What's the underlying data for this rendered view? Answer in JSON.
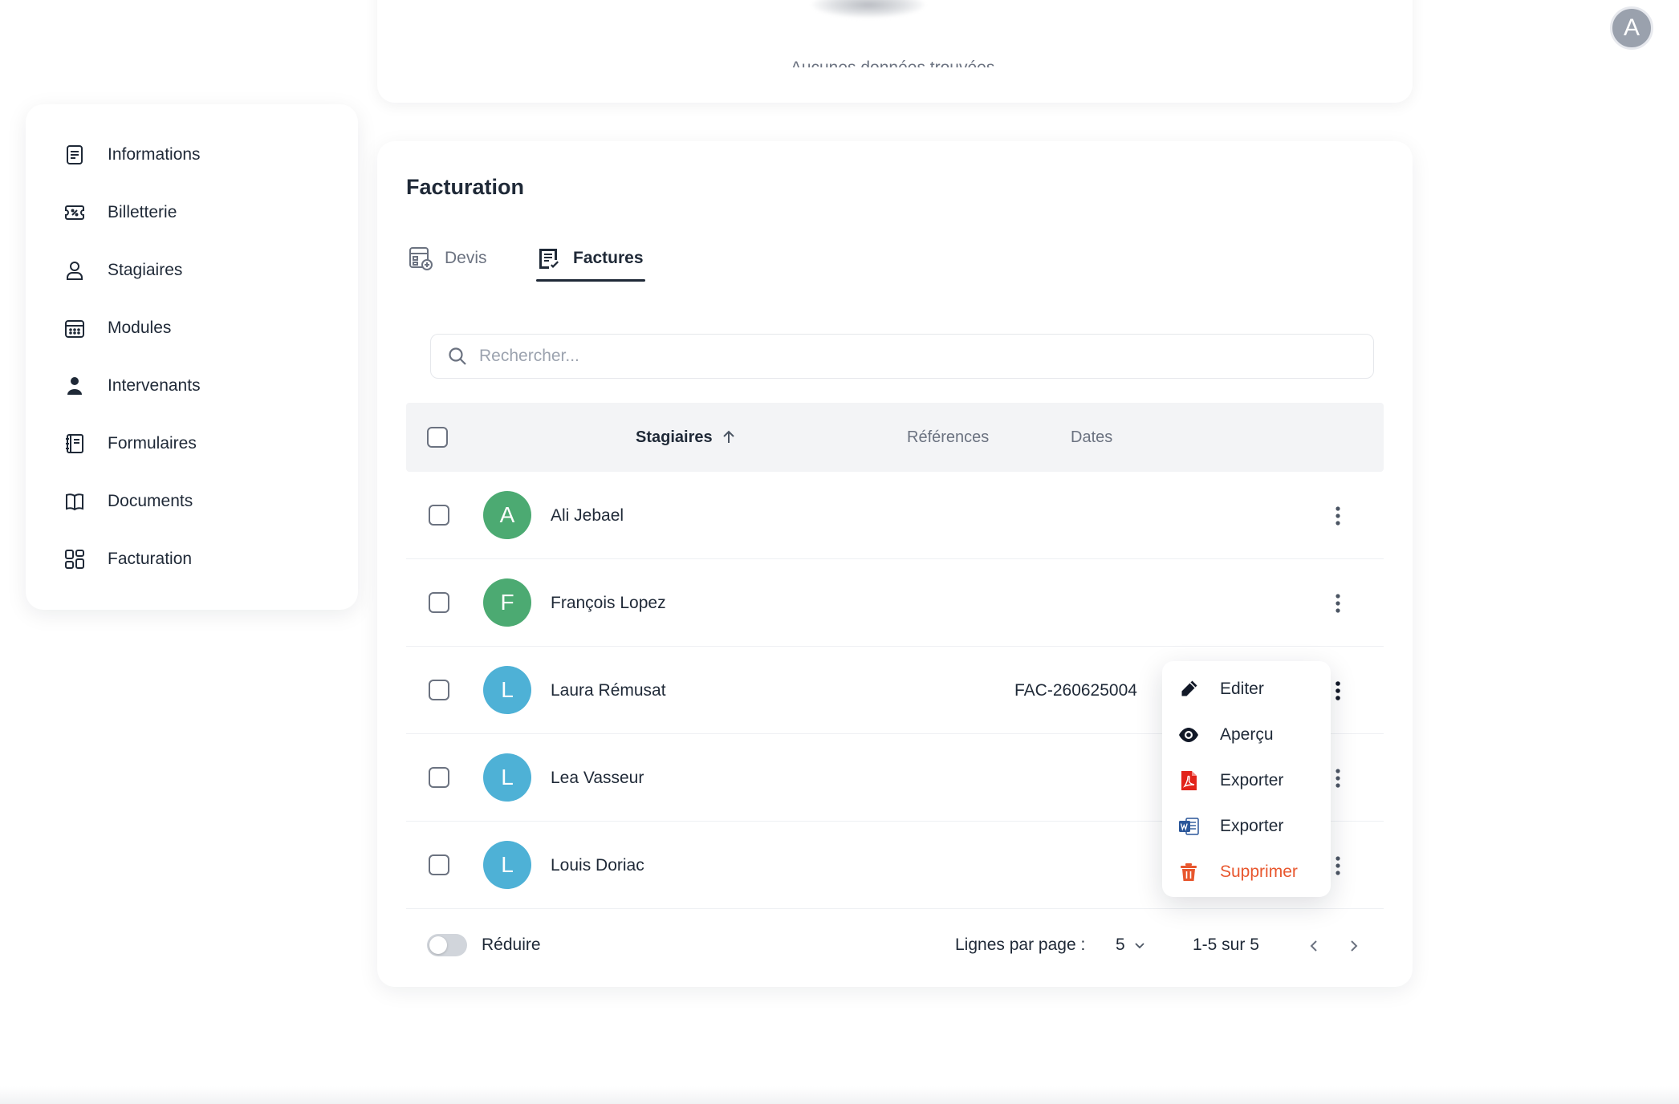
{
  "header": {
    "avatar_letter": "A"
  },
  "top_card": {
    "empty_text": "Aucunes données trouvées."
  },
  "sidebar": {
    "items": [
      {
        "label": "Informations",
        "icon": "document-icon"
      },
      {
        "label": "Billetterie",
        "icon": "ticket-icon"
      },
      {
        "label": "Stagiaires",
        "icon": "user-icon"
      },
      {
        "label": "Modules",
        "icon": "calendar-icon"
      },
      {
        "label": "Intervenants",
        "icon": "person-filled-icon"
      },
      {
        "label": "Formulaires",
        "icon": "form-icon"
      },
      {
        "label": "Documents",
        "icon": "book-icon"
      },
      {
        "label": "Facturation",
        "icon": "grid-icon"
      }
    ]
  },
  "billing": {
    "title": "Facturation",
    "tabs": [
      {
        "label": "Devis",
        "active": false
      },
      {
        "label": "Factures",
        "active": true
      }
    ],
    "search_placeholder": "Rechercher...",
    "columns": {
      "stagiaires": "Stagiaires",
      "references": "Références",
      "dates": "Dates"
    },
    "rows": [
      {
        "initial": "A",
        "name": "Ali Jebael",
        "reference": "",
        "color": "#4caa72"
      },
      {
        "initial": "F",
        "name": "François Lopez",
        "reference": "",
        "color": "#4caa72"
      },
      {
        "initial": "L",
        "name": "Laura Rémusat",
        "reference": "FAC-260625004",
        "color": "#4eb1d6"
      },
      {
        "initial": "L",
        "name": "Lea Vasseur",
        "reference": "",
        "color": "#4eb1d6"
      },
      {
        "initial": "L",
        "name": "Louis Doriac",
        "reference": "",
        "color": "#4eb1d6"
      }
    ],
    "footer": {
      "collapse_label": "Réduire",
      "rows_per_page_label": "Lignes par page :",
      "rows_per_page_value": "5",
      "range": "1-5 sur 5"
    },
    "menu": {
      "items": [
        {
          "label": "Editer",
          "icon": "pencil-icon"
        },
        {
          "label": "Aperçu",
          "icon": "eye-icon"
        },
        {
          "label": "Exporter",
          "icon": "pdf-icon"
        },
        {
          "label": "Exporter",
          "icon": "word-icon"
        },
        {
          "label": "Supprimer",
          "icon": "trash-icon"
        }
      ],
      "danger_color": "#e8572e"
    }
  }
}
